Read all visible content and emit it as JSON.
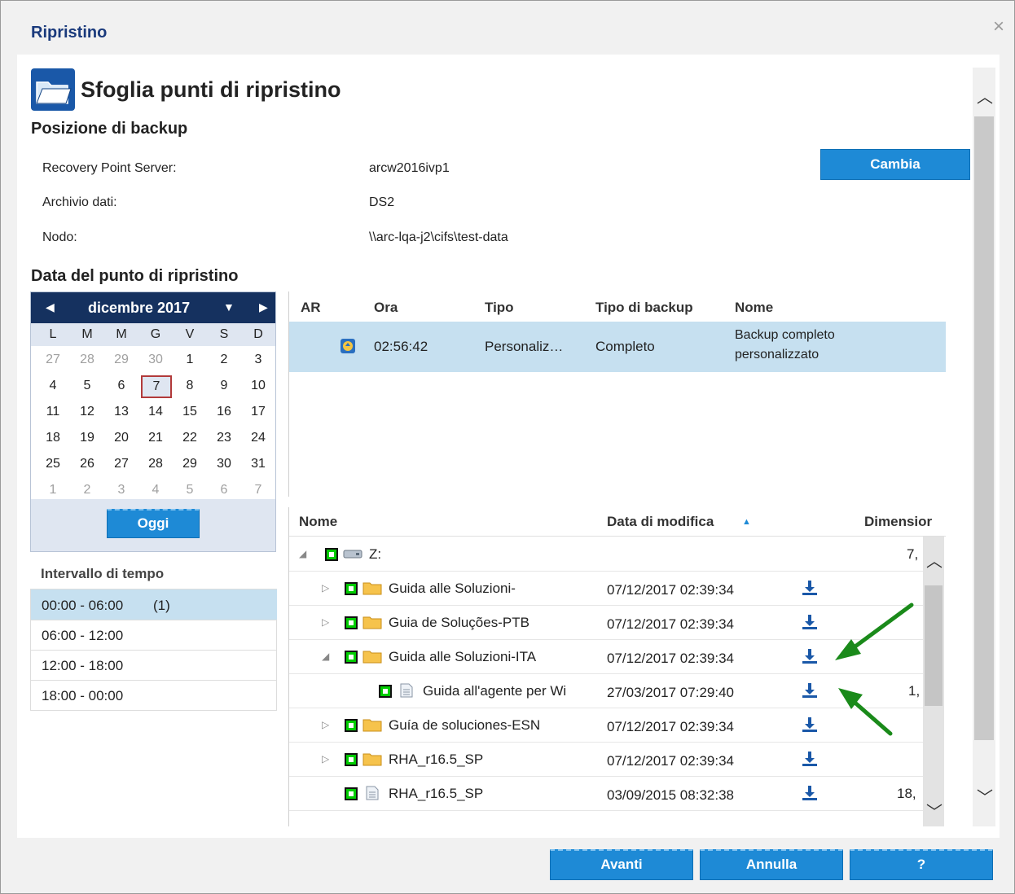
{
  "dialog": {
    "title": "Ripristino",
    "close_glyph": "×"
  },
  "header": {
    "title": "Sfoglia punti di ripristino",
    "icon": "folder-icon"
  },
  "backup_location": {
    "heading": "Posizione di backup",
    "rows": [
      {
        "label": "Recovery Point Server:",
        "value": "arcw2016ivp1"
      },
      {
        "label": "Archivio dati:",
        "value": "DS2"
      },
      {
        "label": "Nodo:",
        "value": "\\\\arc-lqa-j2\\cifs\\test-data"
      }
    ],
    "change_button": "Cambia"
  },
  "recovery_date": {
    "heading": "Data del punto di ripristino",
    "month_label": "dicembre 2017",
    "weekdays": [
      "L",
      "M",
      "M",
      "G",
      "V",
      "S",
      "D"
    ],
    "weeks": [
      [
        "27",
        "28",
        "29",
        "30",
        "1",
        "2",
        "3"
      ],
      [
        "4",
        "5",
        "6",
        "7",
        "8",
        "9",
        "10"
      ],
      [
        "11",
        "12",
        "13",
        "14",
        "15",
        "16",
        "17"
      ],
      [
        "18",
        "19",
        "20",
        "21",
        "22",
        "23",
        "24"
      ],
      [
        "25",
        "26",
        "27",
        "28",
        "29",
        "30",
        "31"
      ],
      [
        "1",
        "2",
        "3",
        "4",
        "5",
        "6",
        "7"
      ]
    ],
    "selected_day": "7",
    "today_button": "Oggi",
    "interval_heading": "Intervallo di tempo",
    "intervals": [
      {
        "label": "00:00 - 06:00",
        "count": "(1)",
        "selected": true
      },
      {
        "label": "06:00 - 12:00",
        "count": "",
        "selected": false
      },
      {
        "label": "12:00 - 18:00",
        "count": "",
        "selected": false
      },
      {
        "label": "18:00 - 00:00",
        "count": "",
        "selected": false
      }
    ]
  },
  "recovery_points": {
    "columns": [
      "AR",
      "Ora",
      "Tipo",
      "Tipo di backup",
      "Nome"
    ],
    "rows": [
      {
        "time": "02:56:42",
        "type": "Personaliz…",
        "backup_type": "Completo",
        "name_line1": "Backup completo",
        "name_line2": "personalizzato"
      }
    ]
  },
  "files": {
    "columns": {
      "name": "Nome",
      "modified": "Data di modifica",
      "size": "Dimensior"
    },
    "sort_glyph": "▲",
    "rows": [
      {
        "name": "Z:",
        "date": "",
        "size": "7,",
        "level": 0,
        "kind": "drive",
        "expander": "◢",
        "download": false
      },
      {
        "name": "Guida alle Soluzioni-",
        "date": "07/12/2017 02:39:34",
        "size": "",
        "level": 1,
        "kind": "folder",
        "expander": "▷",
        "download": true
      },
      {
        "name": "Guia de Soluções-PTB",
        "date": "07/12/2017 02:39:34",
        "size": "",
        "level": 1,
        "kind": "folder",
        "expander": "▷",
        "download": true
      },
      {
        "name": "Guida alle Soluzioni-ITA",
        "date": "07/12/2017 02:39:34",
        "size": "",
        "level": 1,
        "kind": "folder",
        "expander": "◢",
        "download": true
      },
      {
        "name": "Guida all'agente per Wi",
        "date": "27/03/2017 07:29:40",
        "size": "1,",
        "level": 2,
        "kind": "file",
        "expander": "",
        "download": true
      },
      {
        "name": "Guía de soluciones-ESN",
        "date": "07/12/2017 02:39:34",
        "size": "",
        "level": 1,
        "kind": "folder",
        "expander": "▷",
        "download": true
      },
      {
        "name": "RHA_r16.5_SP",
        "date": "07/12/2017 02:39:34",
        "size": "",
        "level": 1,
        "kind": "folder",
        "expander": "▷",
        "download": true
      },
      {
        "name": "RHA_r16.5_SP",
        "date": "03/09/2015 08:32:38",
        "size": "18,",
        "level": 1,
        "kind": "file",
        "expander": "",
        "download": true
      }
    ]
  },
  "footer": {
    "next": "Avanti",
    "cancel": "Annulla",
    "help": "?"
  },
  "colors": {
    "accent": "#1e8ad6",
    "calendar_header": "#15315f",
    "selection": "#c6e0f0",
    "annotation_arrow": "#1a8a1a"
  }
}
